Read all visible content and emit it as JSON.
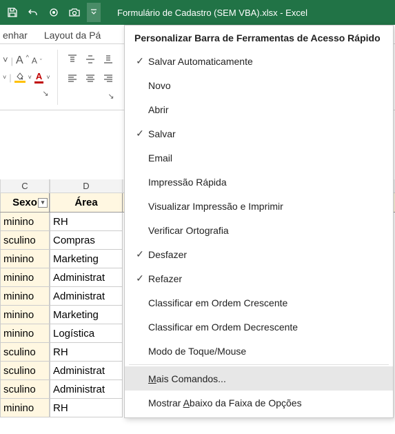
{
  "titlebar": {
    "title": "Formulário de Cadastro (SEM VBA).xlsx  -  Excel"
  },
  "ribbon": {
    "tab1": "enhar",
    "tab2": "Layout da Pá",
    "font_big_A": "A",
    "font_small_A": "A",
    "font_color_A": "A",
    "font_caret": "˅"
  },
  "table": {
    "col_letters": {
      "c": "C",
      "d": "D"
    },
    "headers": {
      "sexo": "Sexo",
      "area": "Área"
    },
    "rows": [
      {
        "sexo": "minino",
        "area": "RH"
      },
      {
        "sexo": "sculino",
        "area": "Compras"
      },
      {
        "sexo": "minino",
        "area": "Marketing"
      },
      {
        "sexo": "minino",
        "area": "Administrat"
      },
      {
        "sexo": "minino",
        "area": "Administrat"
      },
      {
        "sexo": "minino",
        "area": "Marketing"
      },
      {
        "sexo": "minino",
        "area": "Logística"
      },
      {
        "sexo": "sculino",
        "area": "RH"
      },
      {
        "sexo": "sculino",
        "area": "Administrat"
      },
      {
        "sexo": "sculino",
        "area": "Administrat"
      },
      {
        "sexo": "minino",
        "area": "RH"
      }
    ]
  },
  "dropdown": {
    "title": "Personalizar Barra de Ferramentas de Acesso Rápido",
    "items": [
      {
        "label": "Salvar Automaticamente",
        "checked": true
      },
      {
        "label": "Novo",
        "checked": false
      },
      {
        "label": "Abrir",
        "checked": false
      },
      {
        "label": "Salvar",
        "checked": true
      },
      {
        "label": "Email",
        "checked": false
      },
      {
        "label": "Impressão Rápida",
        "checked": false
      },
      {
        "label": "Visualizar Impressão e Imprimir",
        "checked": false
      },
      {
        "label": "Verificar Ortografia",
        "checked": false
      },
      {
        "label": "Desfazer",
        "checked": true
      },
      {
        "label": "Refazer",
        "checked": true
      },
      {
        "label": "Classificar em Ordem Crescente",
        "checked": false
      },
      {
        "label": "Classificar em Ordem Decrescente",
        "checked": false
      },
      {
        "label": "Modo de Toque/Mouse",
        "checked": false
      }
    ],
    "more_pre": "M",
    "more_post": "ais Comandos...",
    "below_pre": "Mostrar ",
    "below_mn": "A",
    "below_post": "baixo da Faixa de Opções"
  }
}
